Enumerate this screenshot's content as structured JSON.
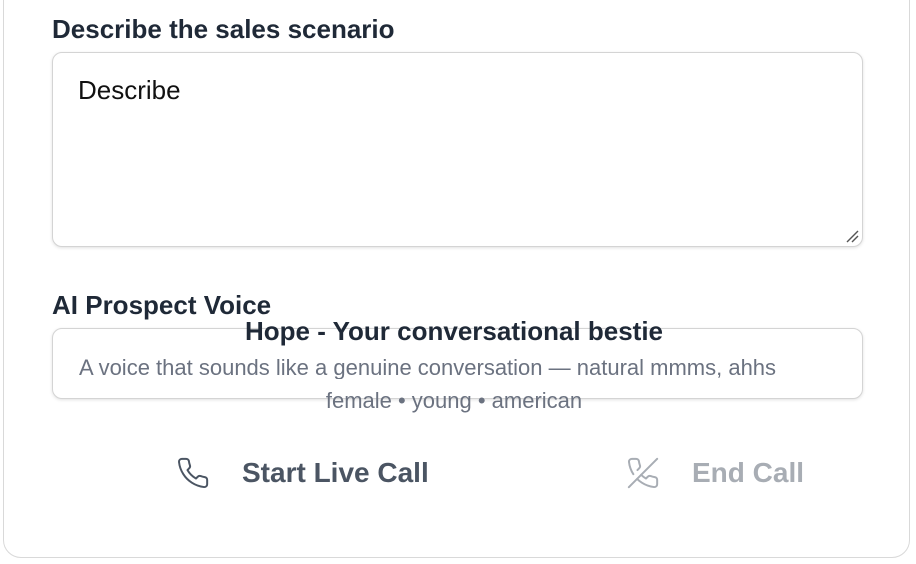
{
  "scenario": {
    "label": "Describe the sales scenario",
    "value": "Describe"
  },
  "voice": {
    "label": "AI Prospect Voice",
    "selected": {
      "title": "Hope - Your conversational bestie",
      "description": "A voice that sounds like a genuine conversation — natural mmms, ahhs",
      "meta": "female • young • american"
    }
  },
  "actions": {
    "start_label": "Start Live Call",
    "end_label": "End Call"
  },
  "colors": {
    "label_text": "#1f2937",
    "muted_text": "#6b7280",
    "disabled_text": "#a8adb4",
    "border": "#d4d4d4"
  },
  "icons": {
    "start": "phone-icon",
    "end": "phone-off-icon"
  }
}
